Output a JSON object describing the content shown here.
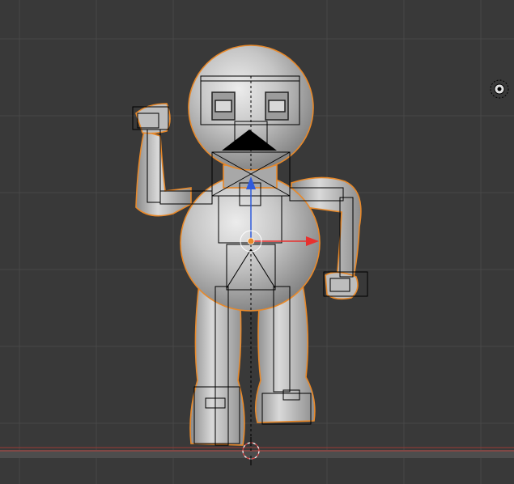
{
  "viewport": {
    "background": "#393939",
    "grid_color": "#474747",
    "object": {
      "name": "robot",
      "surface_color": "#c9c9c9",
      "selection_outline_color": "#e8892a",
      "armature_wire_color": "#000000"
    },
    "widgets": {
      "transform_x_axis_color": "#e8302e",
      "transform_y_axis_color": "#2f5bdc",
      "pivot_color": "#e8892a",
      "x_axis_line_color": "#b3443e",
      "ground_line_color": "#9a3a35",
      "lamp_icon": "lamp-icon",
      "cursor_icon": "3d-cursor-icon"
    }
  }
}
